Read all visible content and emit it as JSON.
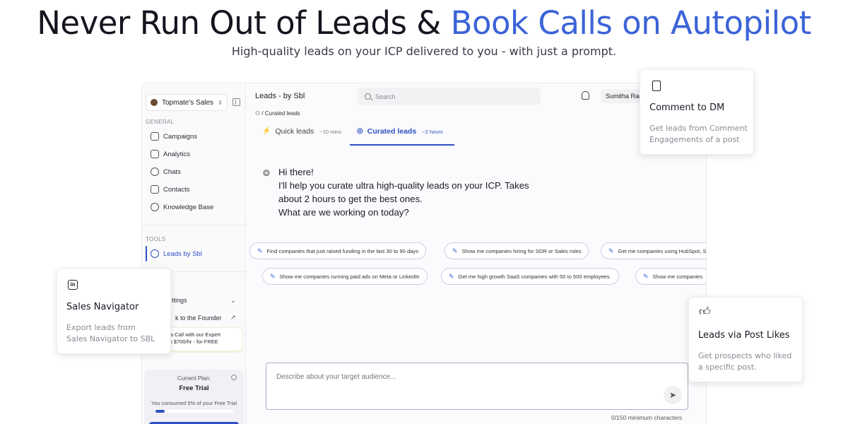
{
  "hero": {
    "title_main": "Never Run Out of Leads & ",
    "title_accent": "Book Calls on Autopilot",
    "subtitle": "High-quality leads on your ICP delivered to you - with just a prompt."
  },
  "colors": {
    "accent": "#3b63d8",
    "primary": "#2f4fc2"
  },
  "sidebar": {
    "workspace": "Topmate's Sales",
    "general_label": "GENERAL",
    "general_items": [
      {
        "label": "Campaigns",
        "icon": "megaphone-icon"
      },
      {
        "label": "Analytics",
        "icon": "grid-icon"
      },
      {
        "label": "Chats",
        "icon": "chat-icon"
      },
      {
        "label": "Contacts",
        "icon": "contact-icon"
      },
      {
        "label": "Knowledge Base",
        "icon": "brain-icon"
      }
    ],
    "tools_label": "TOOLS",
    "tools_items": [
      {
        "label": "Leads by Sbl",
        "icon": "user-plus-icon",
        "active": true
      }
    ],
    "settings_label": "ttings",
    "founder_label": "k to the Founder",
    "promo_text_1": "k a Call with our Expert",
    "promo_text_2": "rth $700/hr - for FREE",
    "plan": {
      "label": "Current Plan:",
      "name": "Free Trial",
      "consumed": "You consumed 5% of your Free Trial",
      "progress": 0.12
    }
  },
  "topbar": {
    "title": "Leads - by Sbl",
    "search_placeholder": "Search",
    "user": "Sumitha Ran"
  },
  "breadcrumb": {
    "separator": "/",
    "current": "Curated leads"
  },
  "tabs": [
    {
      "label": "Quick leads",
      "time": "~10 mins",
      "icon": "bolt-icon"
    },
    {
      "label": "Curated leads",
      "time": "~2 hours",
      "icon": "target-icon",
      "active": true
    }
  ],
  "message": {
    "greeting": "Hi there!",
    "line1": "I'll help you curate ultra high-quality leads on your ICP. Takes",
    "line2": "about 2 hours to get the best ones.",
    "line3": "What are we working on today?"
  },
  "suggestions": [
    "Find companies that just raised funding in the last 30 to 90 days",
    "Show me companies hiring for SDR or Sales roles",
    "Get me companies using HubSpot, S",
    "Show me companies running paid ads on Meta or LinkedIn",
    "Get me high growth SaaS companies with 50 to 500 employees.",
    "Show me companies"
  ],
  "composer": {
    "placeholder": "Describe about your target audience...",
    "char_count": "0/150 minimum characters"
  },
  "cards": {
    "dm": {
      "title": "Comment to DM",
      "desc": "Get leads from Comment Engagements of a post",
      "icon": "document-icon"
    },
    "navigator": {
      "title": "Sales Navigator",
      "desc": "Export leads from Sales Navigator to SBL",
      "icon": "linkedin-icon",
      "icon_text": "in"
    },
    "likes": {
      "title": "Leads via Post Likes",
      "desc": "Get prospects who liked a specific post.",
      "icon": "thumbs-up-icon"
    }
  }
}
